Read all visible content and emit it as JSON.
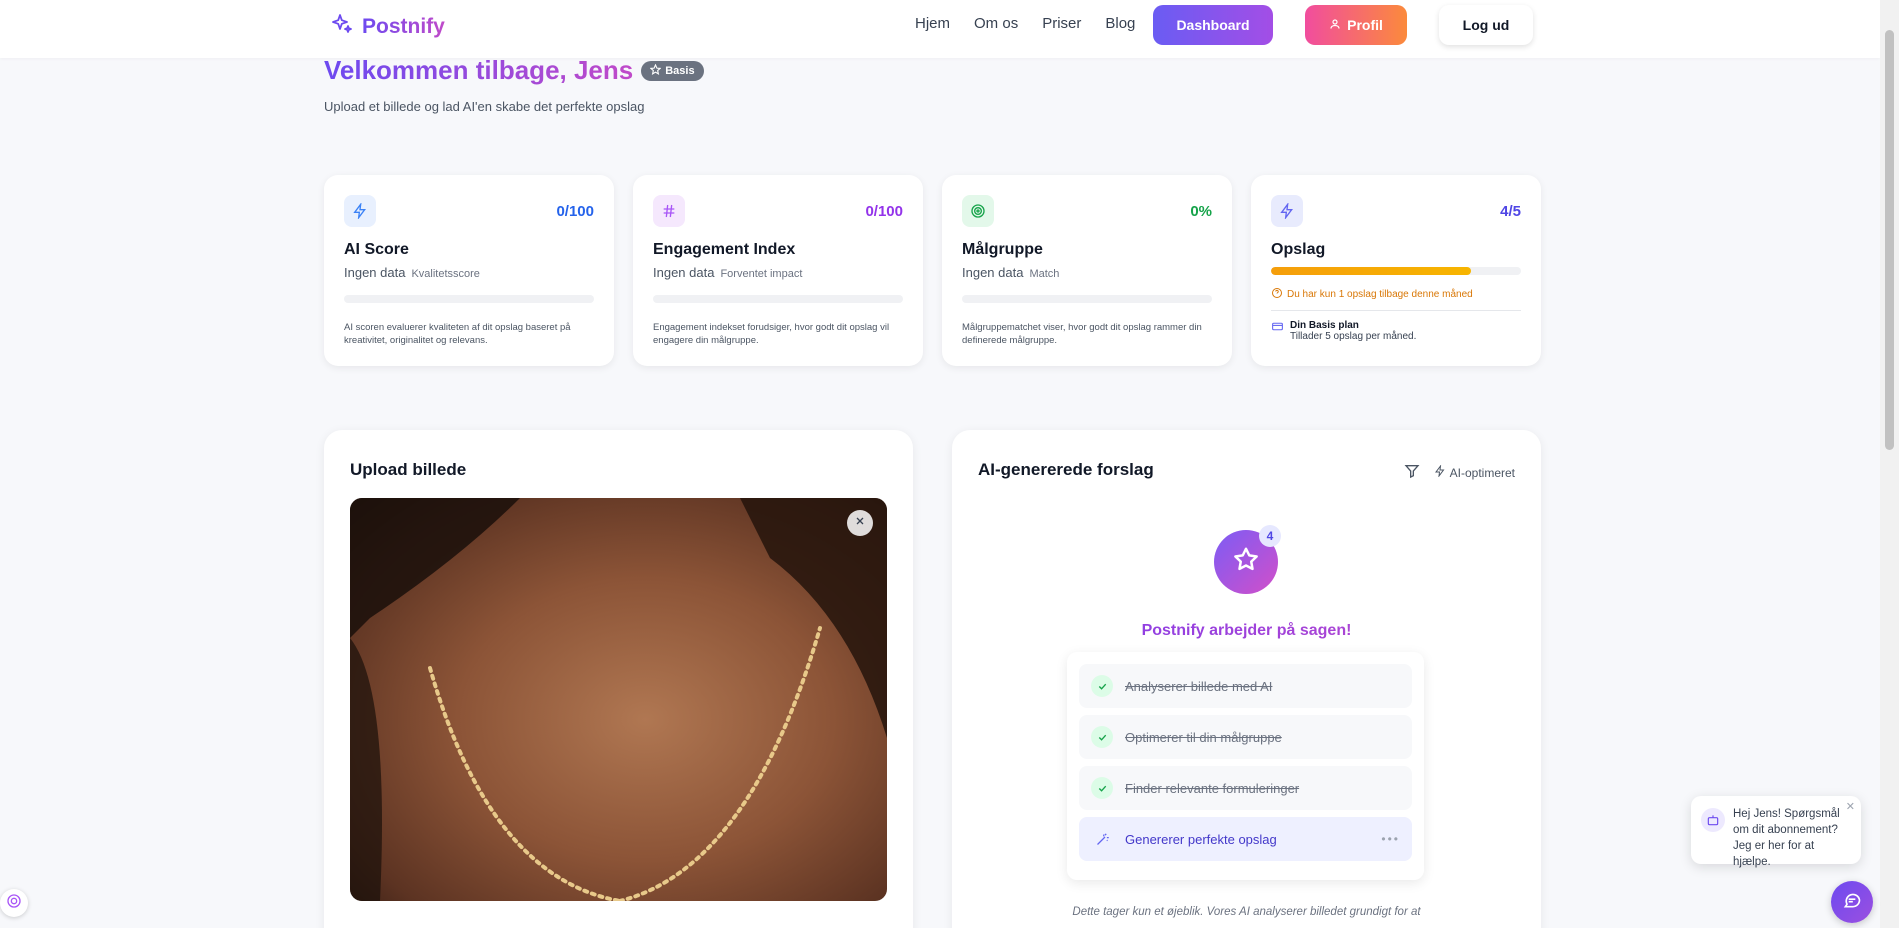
{
  "brand": {
    "name": "Postnify"
  },
  "nav": {
    "home": "Hjem",
    "about": "Om os",
    "pricing": "Priser",
    "blog": "Blog"
  },
  "buttons": {
    "dashboard": "Dashboard",
    "profile": "Profil",
    "logout": "Log ud"
  },
  "welcome": {
    "title": "Velkommen tilbage, Jens",
    "badge": "Basis",
    "subtitle": "Upload et billede og lad AI'en skabe det perfekte opslag"
  },
  "stats": {
    "ai_score": {
      "title": "AI Score",
      "value": "0/100",
      "sub": "Ingen data",
      "sub_label": "Kvalitetsscore",
      "desc": "AI scoren evaluerer kvaliteten af dit opslag baseret på kreativitet, originalitet og relevans."
    },
    "engagement": {
      "title": "Engagement Index",
      "value": "0/100",
      "sub": "Ingen data",
      "sub_label": "Forventet impact",
      "desc": "Engagement indekset forudsiger, hvor godt dit opslag vil engagere din målgruppe."
    },
    "audience": {
      "title": "Målgruppe",
      "value": "0%",
      "sub": "Ingen data",
      "sub_label": "Match",
      "desc": "Målgruppematchet viser, hvor godt dit opslag rammer din definerede målgruppe."
    },
    "posts": {
      "title": "Opslag",
      "value": "4/5",
      "progress": 0.8,
      "warning": "Du har kun 1 opslag tilbage denne måned",
      "plan_title": "Din Basis plan",
      "plan_desc": "Tillader 5 opslag per måned."
    }
  },
  "upload": {
    "title": "Upload billede"
  },
  "ai": {
    "title": "AI-genererede forslag",
    "optimized": "AI-optimeret",
    "count": "4",
    "working": "Postnify arbejder på sagen!",
    "steps": [
      "Analyserer billede med AI",
      "Optimerer til din målgruppe",
      "Finder relevante formuleringer",
      "Genererer perfekte opslag"
    ],
    "note": "Dette tager kun et øjeblik. Vores AI analyserer billedet grundigt for at"
  },
  "chat": {
    "message": "Hej Jens! Spørgsmål om dit abonnement? Jeg er her for at hjælpe."
  },
  "colors": {
    "primary": "#6d4af0",
    "accent": "#c04ac9",
    "orange": "#f59e0b",
    "green": "#16a34a"
  }
}
